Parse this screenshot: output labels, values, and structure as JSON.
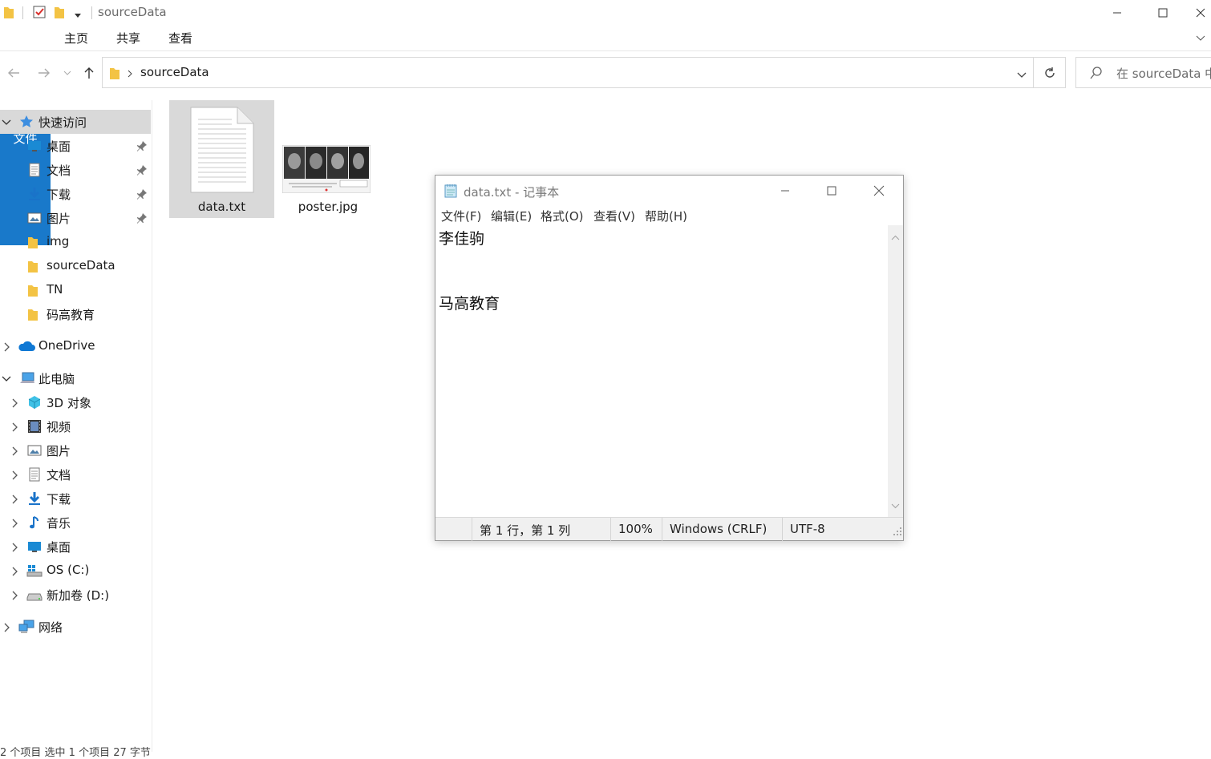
{
  "explorer": {
    "title": "sourceData",
    "ribbon_tabs": [
      "文件",
      "主页",
      "共享",
      "查看"
    ],
    "address": {
      "path": "sourceData"
    },
    "search": {
      "placeholder": "在 sourceData 中搜索"
    },
    "nav": {
      "quick_access": "快速访问",
      "quick_items": [
        "桌面",
        "文档",
        "下载",
        "图片",
        "img",
        "sourceData",
        "TN",
        "码高教育"
      ],
      "onedrive": "OneDrive",
      "this_pc": "此电脑",
      "pc_items": [
        "3D 对象",
        "视频",
        "图片",
        "文档",
        "下载",
        "音乐",
        "桌面",
        "OS (C:)",
        "新加卷 (D:)"
      ],
      "network": "网络"
    },
    "files": [
      {
        "name": "data.txt",
        "icon": "text-file-icon"
      },
      {
        "name": "poster.jpg",
        "icon": "image-thumbnail"
      }
    ],
    "status": "2 个项目    选中 1 个项目  27 字节"
  },
  "notepad": {
    "title": "data.txt - 记事本",
    "menu": [
      "文件(F)",
      "编辑(E)",
      "格式(O)",
      "查看(V)",
      "帮助(H)"
    ],
    "lines": [
      "李佳驹",
      "",
      "",
      "马高教育"
    ],
    "status": {
      "position": "第 1 行，第 1 列",
      "zoom": "100%",
      "line_ending": "Windows (CRLF)",
      "encoding": "UTF-8"
    }
  },
  "colors": {
    "accent": "#1979ca",
    "folder": "#f3c344",
    "selection": "#d9d9d9"
  }
}
